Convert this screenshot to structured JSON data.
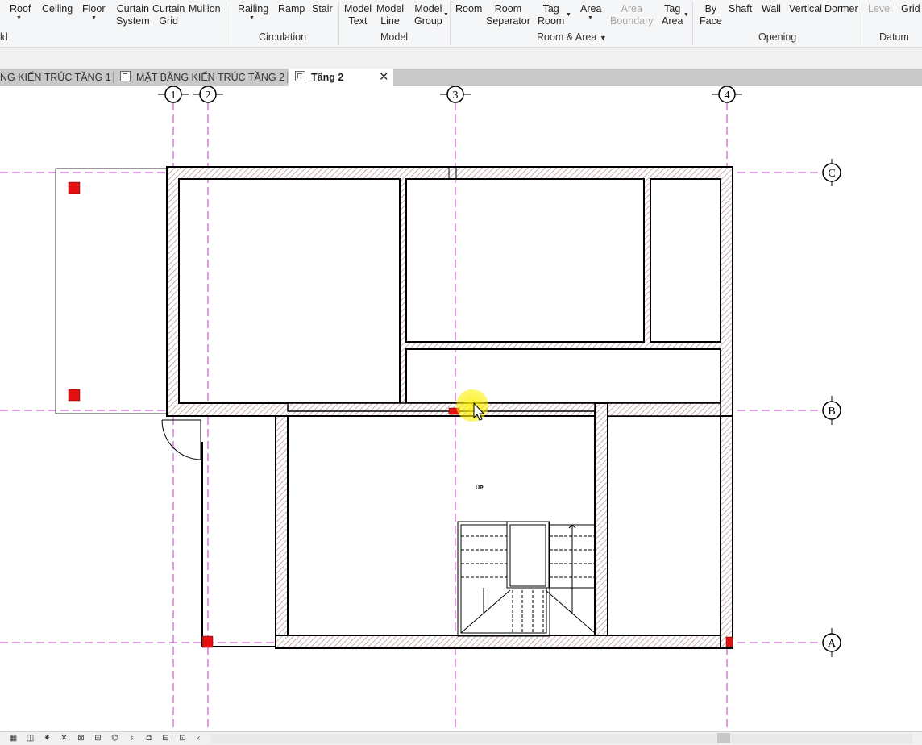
{
  "ribbon": {
    "buttons": {
      "roof": "Roof",
      "ceiling": "Ceiling",
      "floor": "Floor",
      "curtain_system_1": "Curtain",
      "curtain_system_2": "System",
      "curtain_grid_1": "Curtain",
      "curtain_grid_2": "Grid",
      "mullion": "Mullion",
      "railing": "Railing",
      "ramp": "Ramp",
      "stair": "Stair",
      "model_text_1": "Model",
      "model_text_2": "Text",
      "model_line_1": "Model",
      "model_line_2": "Line",
      "model_group_1": "Model",
      "model_group_2": "Group",
      "room": "Room",
      "room_separator_1": "Room",
      "room_separator_2": "Separator",
      "tag_room_1": "Tag",
      "tag_room_2": "Room",
      "area": "Area",
      "area_boundary_1": "Area",
      "area_boundary_2": "Boundary",
      "tag_area_1": "Tag",
      "tag_area_2": "Area",
      "by_face_1": "By",
      "by_face_2": "Face",
      "shaft": "Shaft",
      "wall": "Wall",
      "vertical": "Vertical",
      "dormer": "Dormer",
      "level": "Level",
      "grid": "Grid"
    },
    "panels": {
      "build": "ld",
      "circulation": "Circulation",
      "model": "Model",
      "room_area": "Room & Area",
      "opening": "Opening",
      "datum": "Datum"
    }
  },
  "tabs": [
    {
      "label": "NG KIẾN TRÚC TẦNG 1"
    },
    {
      "label": "MẶT BẰNG KIẾN TRÚC TẦNG 2"
    },
    {
      "label": "Tầng 2"
    }
  ],
  "grids": {
    "vertical": [
      "1",
      "2",
      "3",
      "4"
    ],
    "horizontal": [
      "C",
      "B",
      "A"
    ]
  },
  "stair_label": "UP",
  "colors": {
    "grid_line": "#c43ac4",
    "column_red": "#e31010",
    "hatch": "#b58a8a",
    "cursor_highlight": "#fff000"
  }
}
